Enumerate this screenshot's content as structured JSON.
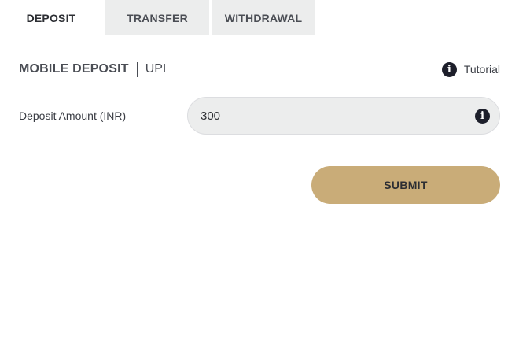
{
  "tabs": [
    {
      "label": "DEPOSIT",
      "active": true
    },
    {
      "label": "TRANSFER",
      "active": false
    },
    {
      "label": "WITHDRAWAL",
      "active": false
    }
  ],
  "section": {
    "title": "MOBILE DEPOSIT",
    "subtitle": "UPI",
    "tutorial_label": "Tutorial",
    "tutorial_icon": "info-icon"
  },
  "form": {
    "amount_label": "Deposit Amount (INR)",
    "amount_value": "300",
    "amount_info_icon": "info-icon",
    "submit_label": "SUBMIT"
  },
  "colors": {
    "accent": "#c9ac78",
    "field_bg": "#eceded",
    "icon_bg": "#1d1f2b",
    "inactive_tab_bg": "#eceded"
  }
}
